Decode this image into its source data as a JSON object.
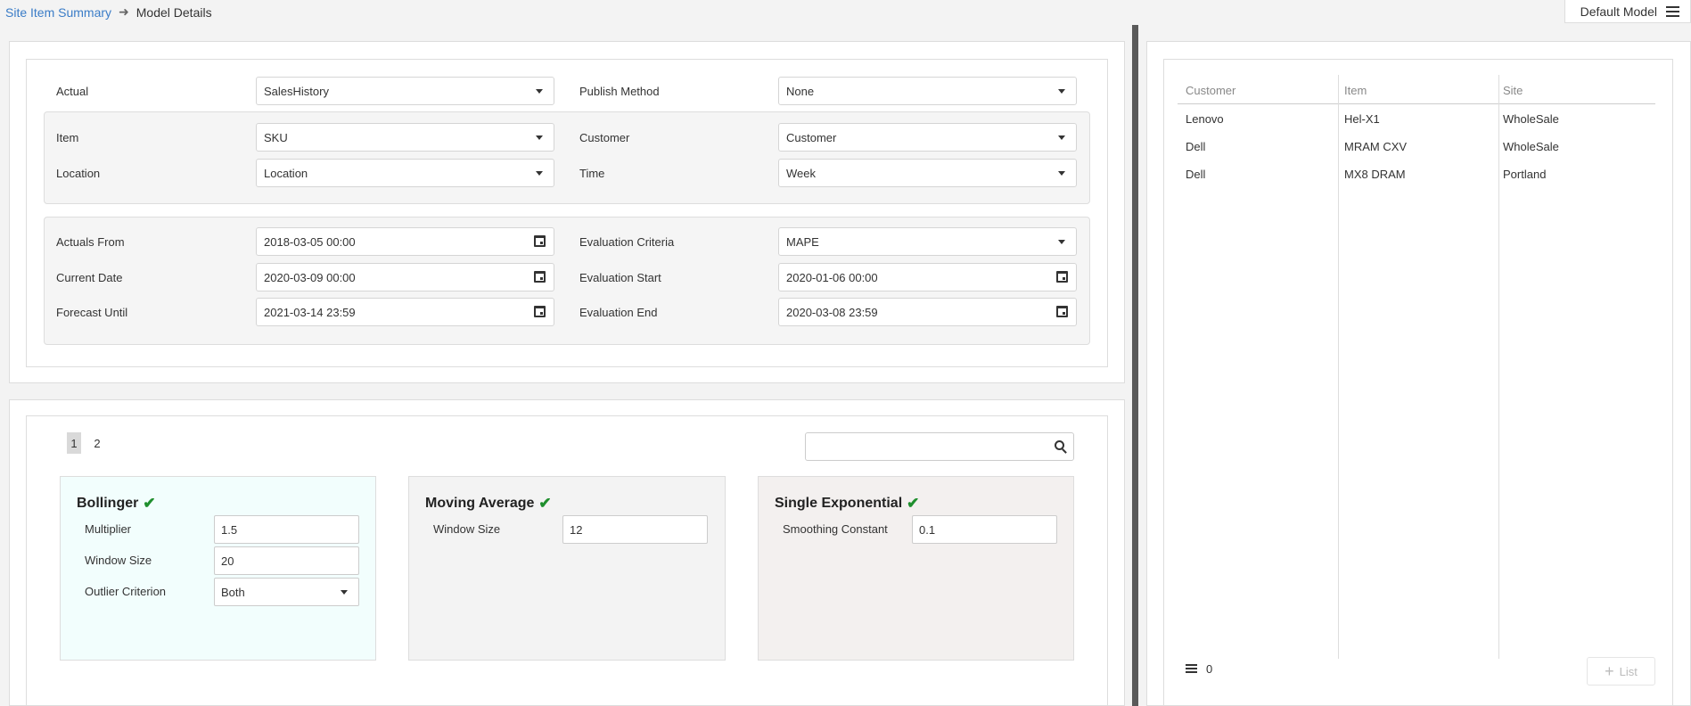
{
  "breadcrumb": {
    "parent": "Site Item Summary",
    "current": "Model Details"
  },
  "header": {
    "model_menu": "Default Model"
  },
  "config": {
    "actual": {
      "label": "Actual",
      "value": "SalesHistory"
    },
    "publish_method": {
      "label": "Publish Method",
      "value": "None"
    },
    "item": {
      "label": "Item",
      "value": "SKU"
    },
    "customer": {
      "label": "Customer",
      "value": "Customer"
    },
    "location": {
      "label": "Location",
      "value": "Location"
    },
    "time": {
      "label": "Time",
      "value": "Week"
    },
    "actuals_from": {
      "label": "Actuals From",
      "value": "2018-03-05 00:00"
    },
    "evaluation_criteria": {
      "label": "Evaluation Criteria",
      "value": "MAPE"
    },
    "current_date": {
      "label": "Current Date",
      "value": "2020-03-09 00:00"
    },
    "evaluation_start": {
      "label": "Evaluation Start",
      "value": "2020-01-06 00:00"
    },
    "forecast_until": {
      "label": "Forecast Until",
      "value": "2021-03-14 23:59"
    },
    "evaluation_end": {
      "label": "Evaluation End",
      "value": "2020-03-08 23:59"
    }
  },
  "pager": {
    "pages": [
      "1",
      "2"
    ],
    "active": "1"
  },
  "search": {
    "placeholder": ""
  },
  "models": [
    {
      "name": "Bollinger",
      "bg": "#f2fefd",
      "params": [
        {
          "label": "Multiplier",
          "value": "1.5"
        },
        {
          "label": "Window Size",
          "value": "20"
        },
        {
          "label": "Outlier Criterion",
          "value": "Both"
        }
      ]
    },
    {
      "name": "Moving Average",
      "bg": "#f3f3f3",
      "params": [
        {
          "label": "Window Size",
          "value": "12"
        }
      ]
    },
    {
      "name": "Single Exponential",
      "bg": "#f3f0ef",
      "params": [
        {
          "label": "Smoothing Constant",
          "value": "0.1"
        }
      ]
    }
  ],
  "grid": {
    "columns": [
      "Customer",
      "Item",
      "Site"
    ],
    "rows": [
      [
        "Lenovo",
        "Hel-X1",
        "WholeSale"
      ],
      [
        "Dell",
        "MRAM CXV",
        "WholeSale"
      ],
      [
        "Dell",
        "MX8 DRAM",
        "Portland"
      ]
    ],
    "count": "0",
    "list_button": "List"
  },
  "colors": {
    "link": "#3a7cc7",
    "check": "#1f8f2e",
    "splitter": "#5a5a5a"
  }
}
